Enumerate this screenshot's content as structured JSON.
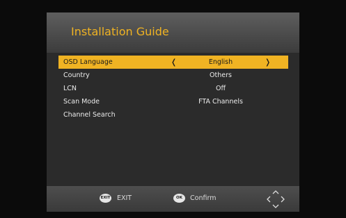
{
  "header": {
    "title": "Installation Guide"
  },
  "menu": {
    "items": [
      {
        "label": "OSD Language",
        "value": "English",
        "selected": true
      },
      {
        "label": "Country",
        "value": "Others"
      },
      {
        "label": "LCN",
        "value": "Off"
      },
      {
        "label": "Scan Mode",
        "value": "FTA Channels"
      },
      {
        "label": "Channel Search",
        "value": ""
      }
    ],
    "arrow_left": "❬",
    "arrow_right": "❭"
  },
  "footer": {
    "exit_key": "EXIT",
    "exit_label": "EXIT",
    "ok_key": "OK",
    "confirm_label": "Confirm",
    "nav_icon": "dpad-icon"
  },
  "colors": {
    "accent": "#f0b323",
    "panel": "#2b2b2b",
    "background": "#0b0b0b"
  }
}
